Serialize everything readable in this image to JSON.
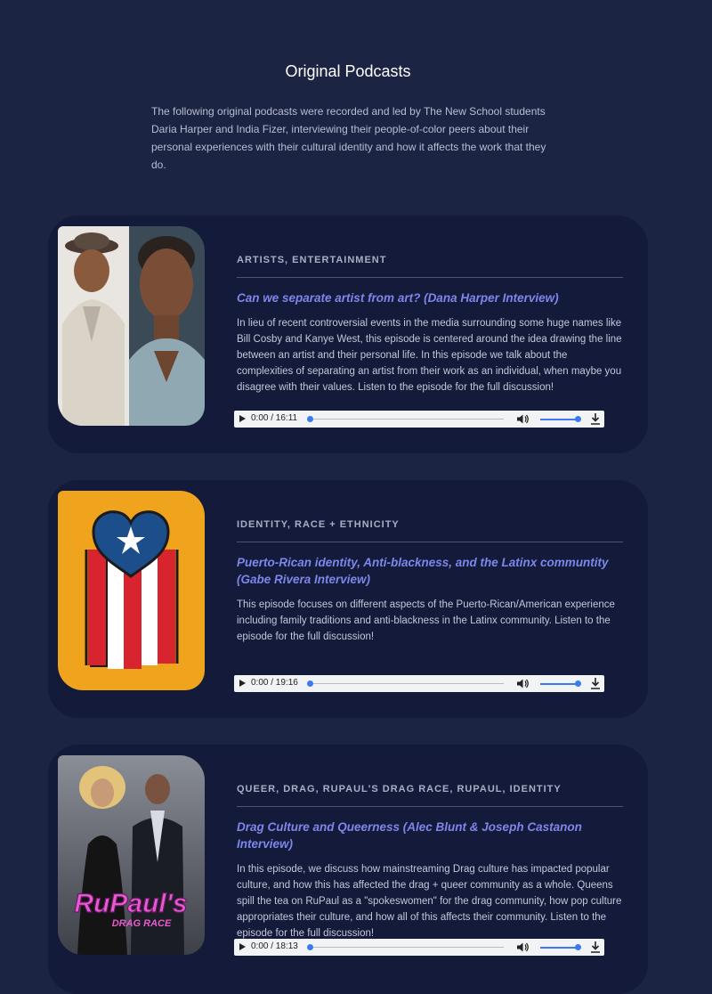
{
  "page": {
    "title": "Original Podcasts",
    "intro": "The following original podcasts were recorded and led by The New School students Daria Harper and India Fizer, interviewing their people-of-color peers about their personal experiences with their cultural identity and how it affects the work that they do."
  },
  "episodes": [
    {
      "tags": "ARTISTS, ENTERTAINMENT",
      "title": "Can we separate artist from art? (Dana Harper Interview)",
      "description": "In lieu of recent controversial events in the media surrounding some huge names like Bill Cosby and Kanye West, this episode is centered around the idea drawing the line between an artist and their personal life. In this episode we talk about the complexities of separating an artist from their work as an individual, when maybe you disagree with their values. Listen to the episode for the full discussion!",
      "time": "0:00 / 16:11",
      "image": "bill-cosby-kanye-west-photo"
    },
    {
      "tags": "IDENTITY, RACE + ETHNICITY",
      "title": "Puerto-Rican identity, Anti-blackness, and the Latinx communtity (Gabe Rivera Interview)",
      "description": "This episode focuses on different aspects of the Puerto-Rican/American experience including family traditions and anti-blackness in the Latinx community. Listen to the episode for the full discussion!",
      "time": "0:00 / 19:16",
      "image": "puerto-rico-heart-flag-illustration"
    },
    {
      "tags": "QUEER, DRAG, RUPAUL'S DRAG RACE, RUPAUL, IDENTITY",
      "title": "Drag Culture and Queerness (Alec Blunt & Joseph Castanon Interview)",
      "description": "In this episode, we discuss how mainstreaming Drag culture has impacted popular culture, and how this has affected the drag + queer community as a whole. Queens spill the tea on RuPaul as a \"spokeswomen\" for the drag community, how pop culture appropriates their culture, and how all of this affects their community. Listen to the episode for the full discussion!",
      "time": "0:00 / 18:13",
      "image": "rupauls-drag-race-promo",
      "logo_text": "RuPaul's",
      "logo_subtext": "DRAG RACE"
    }
  ],
  "colors": {
    "background": "#1c2444",
    "card": "#141b3a",
    "title_link": "#7d86ea",
    "player_accent": "#3a7bf2"
  }
}
